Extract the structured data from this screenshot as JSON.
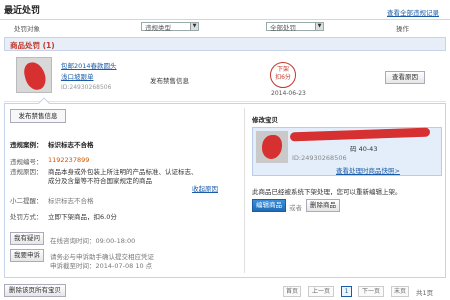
{
  "page": {
    "title": "最近处罚",
    "view_all_link": "查看全部违规记录"
  },
  "columns": {
    "target": "处罚对象",
    "type_select": "违规类型",
    "all_select": "全部处罚",
    "action": "操作"
  },
  "section": {
    "title": "商品处罚 (1)"
  },
  "item": {
    "title_line1": "包邮2014春款圆头",
    "title_line2": "浅口坡跟单",
    "id": "ID:24930268506",
    "violation": "发布禁售信息",
    "badge_line1": "下架",
    "badge_line2": "扣6分",
    "date": "2014-06-23",
    "view_reason": "查看原因"
  },
  "detail": {
    "tab": "发布禁售信息",
    "case_label": "违规案例：",
    "case_value": "标识标志不合格",
    "number_label": "违规编号：",
    "number_value": "1192237899",
    "reason_label": "违规原因：",
    "reason_line1": "商品本身或外包装上所注明的产品标准、认证标志、",
    "reason_line2": "成分及含量等不符合国家规定的商品",
    "collapse": "收起原因",
    "tip_label": "小二提醒：",
    "tip_value": "标识标志不合格",
    "penalty_label": "处罚方式：",
    "penalty_value": "立即下架商品，扣6.0分",
    "question_btn": "我有疑问",
    "question_text": "在线咨询时间：09:00-18:00",
    "appeal_btn": "我要申诉",
    "appeal_text": "请务必与申诉助手确认提交相应凭证",
    "appeal_deadline": "申诉截至时间：2014-07-08 10 点"
  },
  "fix": {
    "title": "修改宝贝",
    "item_line": "码 40-43",
    "item_id": "ID:24930268506",
    "view_processed": "查看处理时商品快照>",
    "notice": "此商品已经被系统下架处理，您可以重新编辑上架。",
    "edit_btn": "编辑商品",
    "or": "或者",
    "delete_btn": "删除商品"
  },
  "bottom": {
    "delete_all_btn": "删除该页所有宝贝"
  },
  "pagination": {
    "first": "首页",
    "prev": "上一页",
    "current": "1",
    "next": "下一页",
    "last": "末页",
    "total": "共1页"
  }
}
